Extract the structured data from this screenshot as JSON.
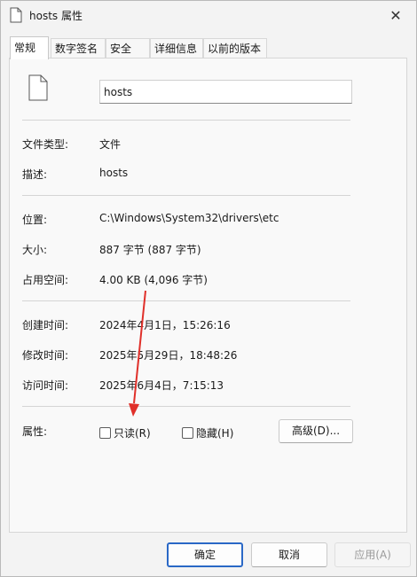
{
  "window": {
    "title": "hosts 属性",
    "close_glyph": "✕"
  },
  "tabs": [
    {
      "label": "常规",
      "active": true
    },
    {
      "label": "数字签名",
      "active": false
    },
    {
      "label": "安全",
      "active": false
    },
    {
      "label": "详细信息",
      "active": false
    },
    {
      "label": "以前的版本",
      "active": false
    }
  ],
  "general": {
    "file_name": "hosts",
    "file_type_label": "文件类型:",
    "file_type_value": "文件",
    "description_label": "描述:",
    "description_value": "hosts",
    "location_label": "位置:",
    "location_value": "C:\\Windows\\System32\\drivers\\etc",
    "size_label": "大小:",
    "size_value": "887 字节 (887 字节)",
    "size_on_disk_label": "占用空间:",
    "size_on_disk_value": "4.00 KB (4,096 字节)",
    "created_label": "创建时间:",
    "created_value": "2024年4月1日，15:26:16",
    "modified_label": "修改时间:",
    "modified_value": "2025年5月29日，18:48:26",
    "accessed_label": "访问时间:",
    "accessed_value": "2025年6月4日，7:15:13",
    "attributes_label": "属性:",
    "readonly_label": "只读(R)",
    "readonly_checked": false,
    "hidden_label": "隐藏(H)",
    "hidden_checked": false,
    "advanced_label": "高级(D)..."
  },
  "footer": {
    "ok_label": "确定",
    "cancel_label": "取消",
    "apply_label": "应用(A)"
  },
  "colors": {
    "accent": "#2a68c6",
    "annotation_arrow": "#e0302a"
  }
}
